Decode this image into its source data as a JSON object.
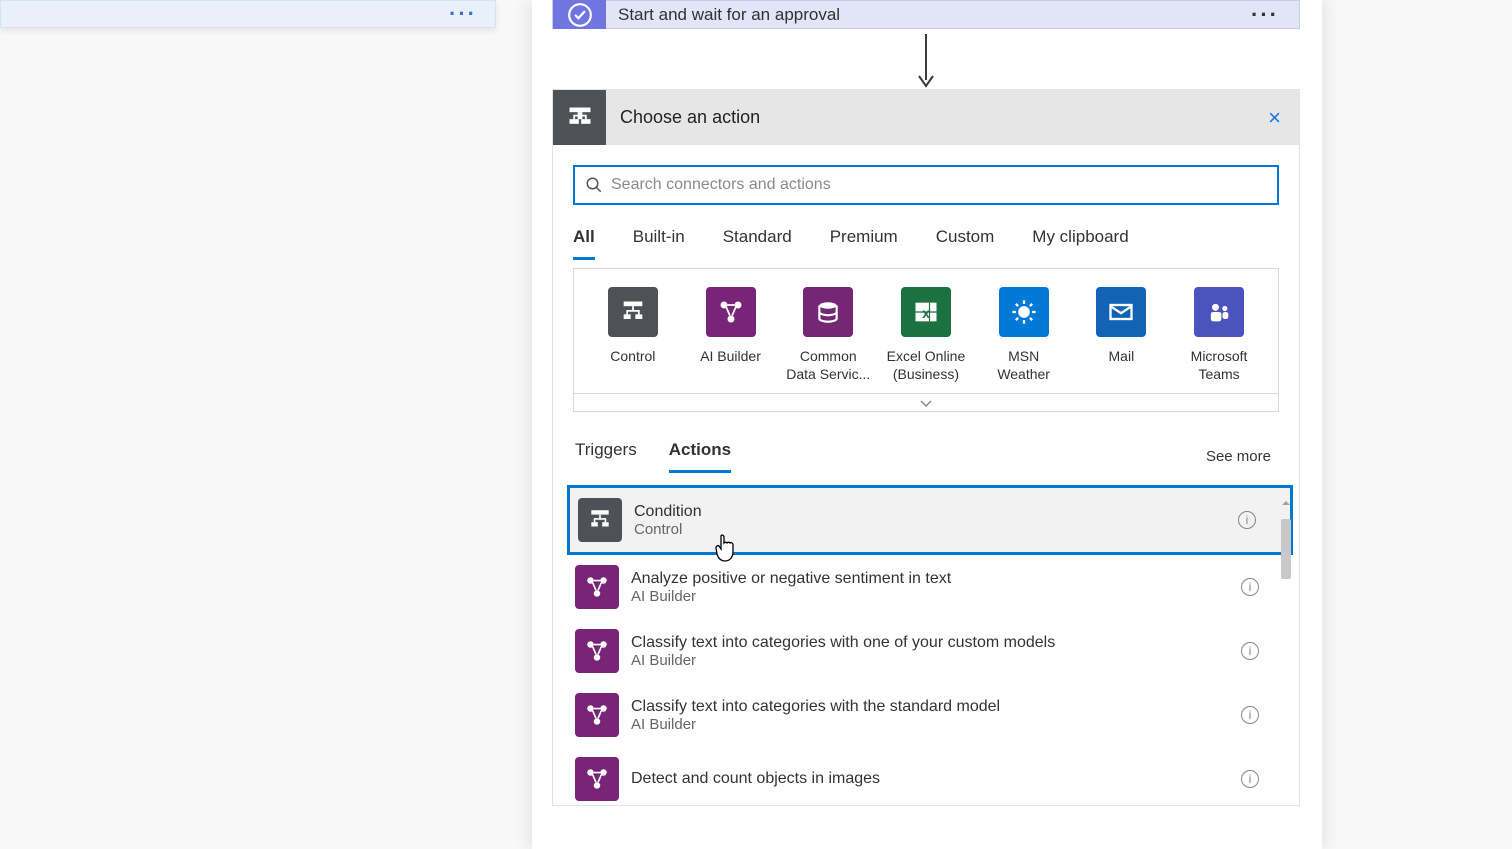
{
  "prevCard": {
    "menu": "···"
  },
  "approval": {
    "title": "Start and wait for an approval",
    "menu": "···"
  },
  "choose": {
    "title": "Choose an action",
    "close": "×",
    "searchPlaceholder": "Search connectors and actions"
  },
  "catTabs": [
    "All",
    "Built-in",
    "Standard",
    "Premium",
    "Custom",
    "My clipboard"
  ],
  "connectors": [
    {
      "label": "Control"
    },
    {
      "label": "AI Builder"
    },
    {
      "label": "Common\nData Servic..."
    },
    {
      "label": "Excel Online\n(Business)"
    },
    {
      "label": "MSN\nWeather"
    },
    {
      "label": "Mail"
    },
    {
      "label": "Microsoft\nTeams"
    }
  ],
  "trigTabs": [
    "Triggers",
    "Actions"
  ],
  "seeMore": "See more",
  "actions": [
    {
      "title": "Condition",
      "sub": "Control",
      "icon": "control",
      "hl": true
    },
    {
      "title": "Analyze positive or negative sentiment in text",
      "sub": "AI Builder",
      "icon": "ai"
    },
    {
      "title": "Classify text into categories with one of your custom models",
      "sub": "AI Builder",
      "icon": "ai"
    },
    {
      "title": "Classify text into categories with the standard model",
      "sub": "AI Builder",
      "icon": "ai"
    },
    {
      "title": "Detect and count objects in images",
      "sub": "AI Builder",
      "icon": "ai"
    }
  ],
  "info": "i"
}
